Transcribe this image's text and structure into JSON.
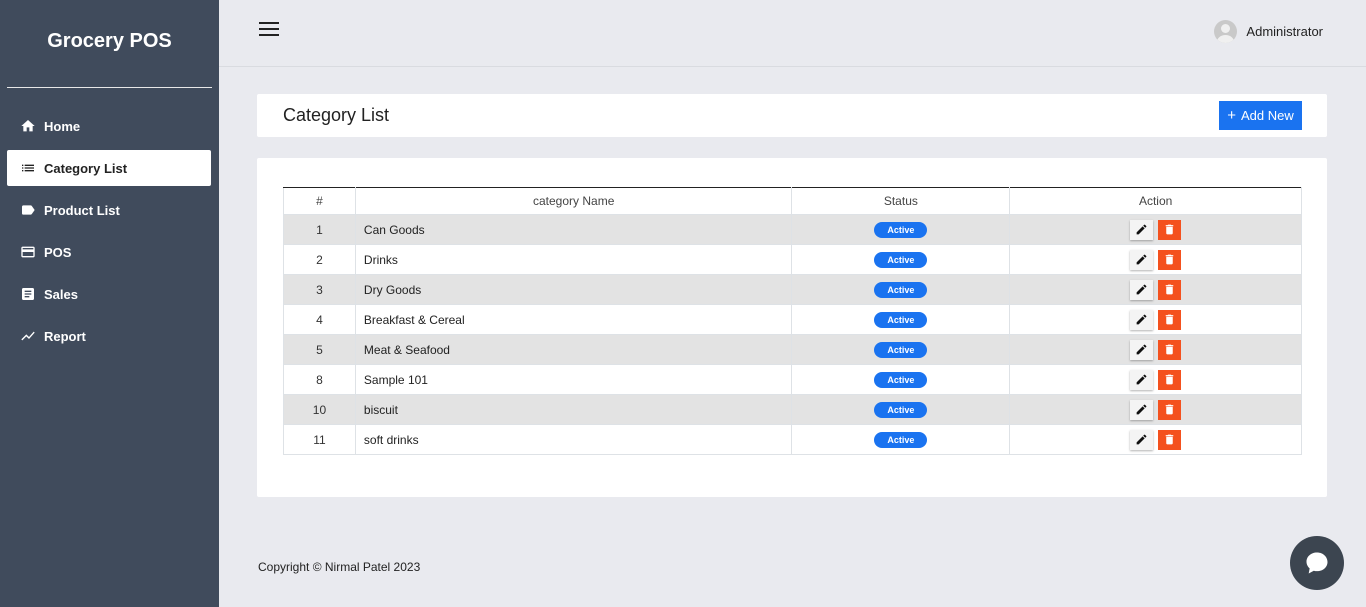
{
  "sidebar": {
    "brand": "Grocery POS",
    "items": [
      {
        "label": "Home",
        "icon": "home-icon",
        "active": false
      },
      {
        "label": "Category List",
        "icon": "list-icon",
        "active": true
      },
      {
        "label": "Product List",
        "icon": "tag-icon",
        "active": false
      },
      {
        "label": "POS",
        "icon": "credit-card-icon",
        "active": false
      },
      {
        "label": "Sales",
        "icon": "document-icon",
        "active": false
      },
      {
        "label": "Report",
        "icon": "trend-icon",
        "active": false
      }
    ]
  },
  "topbar": {
    "user_name": "Administrator"
  },
  "header": {
    "title": "Category List",
    "add_button_label": "Add New"
  },
  "table": {
    "columns": [
      "#",
      "category Name",
      "Status",
      "Action"
    ],
    "rows": [
      {
        "id": "1",
        "name": "Can Goods",
        "status": "Active"
      },
      {
        "id": "2",
        "name": "Drinks",
        "status": "Active"
      },
      {
        "id": "3",
        "name": "Dry Goods",
        "status": "Active"
      },
      {
        "id": "4",
        "name": "Breakfast & Cereal",
        "status": "Active"
      },
      {
        "id": "5",
        "name": "Meat & Seafood",
        "status": "Active"
      },
      {
        "id": "8",
        "name": "Sample 101",
        "status": "Active"
      },
      {
        "id": "10",
        "name": "biscuit",
        "status": "Active"
      },
      {
        "id": "11",
        "name": "soft drinks",
        "status": "Active"
      }
    ]
  },
  "footer": {
    "copyright": "Copyright © Nirmal Patel 2023"
  },
  "colors": {
    "sidebar_bg": "#404b5c",
    "accent": "#1a73f0",
    "delete": "#f4511e",
    "page_bg": "#e9eaef"
  }
}
